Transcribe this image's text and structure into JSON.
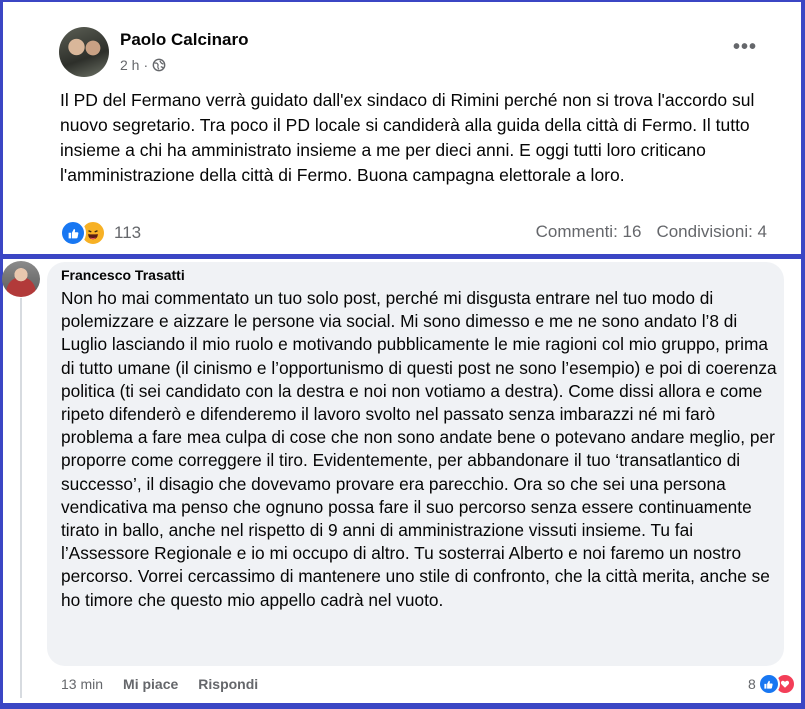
{
  "post": {
    "author": "Paolo Calcinaro",
    "time": "2 h",
    "separator": "·",
    "privacy_icon": "globe-icon",
    "more_label": "•••",
    "text": "Il PD del Fermano verrà guidato dall'ex sindaco di Rimini perché non si trova l'accordo sul nuovo segretario. Tra poco il PD locale si candiderà alla guida della città di Fermo. Il tutto insieme a chi ha amministrato insieme a me per dieci anni. E oggi tutti loro criticano l'amministrazione della città di Fermo. Buona campagna elettorale a loro.",
    "reactions_count": "113",
    "reaction_icons": [
      "like-icon",
      "haha-icon"
    ],
    "comments": "Commenti: 16",
    "shares": "Condivisioni: 4"
  },
  "comment": {
    "author": "Francesco Trasatti",
    "text": "Non ho mai commentato un tuo solo post, perché mi disgusta entrare nel tuo modo di polemizzare e aizzare le persone via social. Mi sono dimesso e me ne sono andato l’8 di Luglio lasciando il mio ruolo e motivando pubblicamente le mie ragioni col mio gruppo, prima di tutto umane (il cinismo e l’opportunismo di questi post ne sono l’esempio) e poi di coerenza politica (ti sei candidato con la destra e noi non votiamo a destra). Come dissi allora e come ripeto difenderò e difenderemo il lavoro svolto nel passato senza imbarazzi né mi farò problema a fare mea culpa di cose che non sono andate bene o potevano andare meglio, per proporre come correggere il tiro. Evidentemente, per abbandonare il tuo ‘transatlantico di successo’, il disagio che dovevamo provare era parecchio. Ora so che sei una persona vendicativa ma penso che ognuno possa fare il suo percorso senza essere continuamente tirato in ballo, anche nel rispetto di 9 anni di amministrazione vissuti insieme. Tu fai l’Assessore Regionale e io mi occupo di altro. Tu sosterrai Alberto e noi faremo un nostro percorso. Vorrei cercassimo di mantenere uno stile di confronto, che la città merita, anche se ho timore che questo mio appello cadrà nel vuoto.",
    "time": "13 min",
    "like_label": "Mi piace",
    "reply_label": "Rispondi",
    "reactions_count": "8",
    "reaction_icons": [
      "like-icon",
      "love-icon"
    ]
  },
  "colors": {
    "frame": "#3b46c4",
    "secondary_text": "#65676b",
    "bubble": "#f0f2f5",
    "like_blue": "#1877f2"
  }
}
